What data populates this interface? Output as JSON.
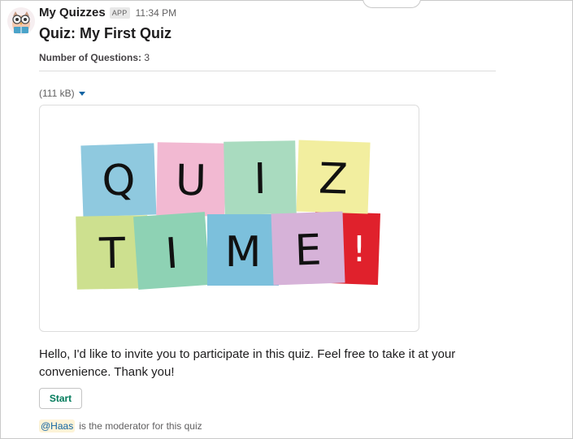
{
  "message": {
    "app_name": "My Quizzes",
    "app_badge": "APP",
    "timestamp": "11:34 PM",
    "avatar_icon": "owl-icon",
    "quiz_title": "Quiz: My First Quiz",
    "questions_label": "Number of Questions:",
    "questions_count": "3",
    "file_size": "(111 kB)",
    "image": {
      "icon": "quiz-time-image",
      "letters_row1": [
        "Q",
        "U",
        "I",
        "Z"
      ],
      "letters_row2": [
        "T",
        "I",
        "M",
        "E",
        "!"
      ],
      "note_colors": [
        "#8fc9df",
        "#f2b9d2",
        "#a9dbbf",
        "#f2ee9f",
        "#cde08f",
        "#8ed2b4",
        "#7cc0dc",
        "#d6b2d8",
        "#e0212c"
      ]
    },
    "body_text": "Hello, I'd like to invite you to participate in this quiz. Feel free to take it at your convenience. Thank you!",
    "start_button": "Start",
    "moderator_mention": "@Haas",
    "moderator_text": "is the moderator for this quiz"
  },
  "colors": {
    "start_text": "#007a5a",
    "link": "#1264a3",
    "mention_bg": "#fdf3d7"
  }
}
